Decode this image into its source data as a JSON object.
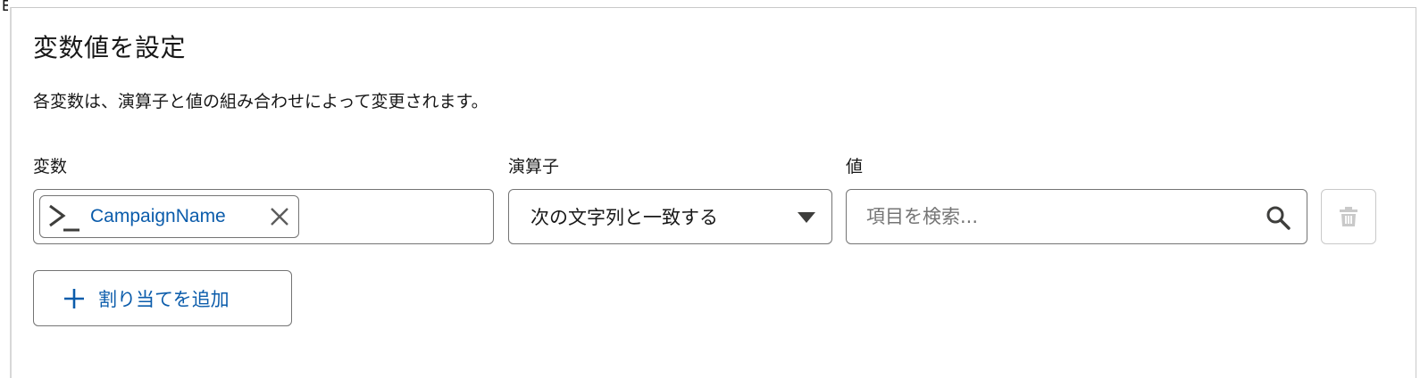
{
  "edge": {
    "glyph": "目"
  },
  "section": {
    "title": "変数値を設定",
    "description": "各変数は、演算子と値の組み合わせによって変更されます。"
  },
  "columns": {
    "variable_label": "変数",
    "operator_label": "演算子",
    "value_label": "値"
  },
  "row": {
    "variable": {
      "icon": "terminal-icon",
      "name": "CampaignName",
      "remove_icon": "close-icon"
    },
    "operator": {
      "selected": "次の文字列と一致する",
      "icon": "caret-down-icon"
    },
    "value": {
      "placeholder": "項目を検索...",
      "icon": "search-icon"
    },
    "delete_icon": "trash-icon"
  },
  "actions": {
    "add_label": "割り当てを追加",
    "add_icon": "plus-icon"
  },
  "colors": {
    "accent": "#0b5cab",
    "border": "#747474",
    "disabled": "#c9c9c9",
    "text": "#181818"
  }
}
